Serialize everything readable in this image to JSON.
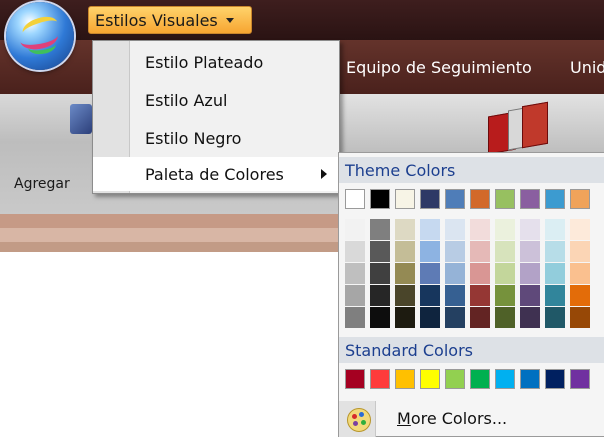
{
  "menu_bar": {
    "styles_menu_label": "Estilos Visuales"
  },
  "top_nav": {
    "items": [
      "Equipo de Seguimiento",
      "Unid"
    ]
  },
  "ribbon": {
    "button_label": "Agregar"
  },
  "styles_menu": {
    "items": [
      {
        "label": "Estilo Plateado"
      },
      {
        "label": "Estilo Azul"
      },
      {
        "label": "Estilo Negro"
      },
      {
        "label": "Paleta de Colores"
      }
    ]
  },
  "color_palette": {
    "theme_header": "Theme Colors",
    "standard_header": "Standard Colors",
    "more_colors_label": "More Colors...",
    "theme_top_row": [
      "#ffffff",
      "#000000",
      "#f7f4e6",
      "#2e3966",
      "#4f7db8",
      "#d2692a",
      "#97c060",
      "#8a5fa0",
      "#3c9bd0",
      "#f0a35a"
    ],
    "theme_shades": [
      [
        "#f2f2f2",
        "#d9d9d9",
        "#bfbfbf",
        "#a6a6a6",
        "#7f7f7f"
      ],
      [
        "#7f7f7f",
        "#595959",
        "#404040",
        "#262626",
        "#0d0d0d"
      ],
      [
        "#ddd9c3",
        "#c4bd97",
        "#948a54",
        "#4a452a",
        "#1d1b10"
      ],
      [
        "#c6d9f0",
        "#8db3e2",
        "#5e7bb5",
        "#17365d",
        "#0f243e"
      ],
      [
        "#dbe5f1",
        "#b8cce4",
        "#95b3d7",
        "#366092",
        "#244061"
      ],
      [
        "#f2dcdb",
        "#e5b9b7",
        "#d99694",
        "#953734",
        "#632423"
      ],
      [
        "#ebf1dd",
        "#d7e3bc",
        "#c3d69b",
        "#76923c",
        "#4f6128"
      ],
      [
        "#e5e0ec",
        "#ccc1d9",
        "#b2a2c7",
        "#5f497a",
        "#3f3151"
      ],
      [
        "#dbeef3",
        "#b7dde8",
        "#92cddc",
        "#31859b",
        "#205867"
      ],
      [
        "#fdeada",
        "#fbd5b5",
        "#fac08f",
        "#e36c09",
        "#974806"
      ]
    ],
    "standard_row": [
      "#a50021",
      "#ff3b3b",
      "#ffc000",
      "#ffff00",
      "#92d050",
      "#00b050",
      "#00b0f0",
      "#0070c0",
      "#002060",
      "#7030a0"
    ]
  }
}
